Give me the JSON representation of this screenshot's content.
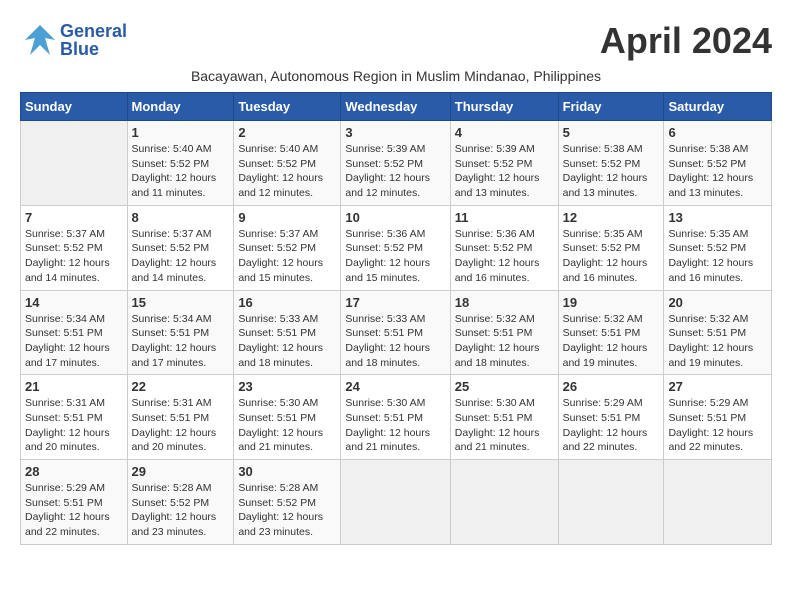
{
  "header": {
    "logo_general": "General",
    "logo_blue": "Blue",
    "month_title": "April 2024",
    "subtitle": "Bacayawan, Autonomous Region in Muslim Mindanao, Philippines"
  },
  "calendar": {
    "days_of_week": [
      "Sunday",
      "Monday",
      "Tuesday",
      "Wednesday",
      "Thursday",
      "Friday",
      "Saturday"
    ],
    "weeks": [
      [
        {
          "day": "",
          "sunrise": "",
          "sunset": "",
          "daylight": ""
        },
        {
          "day": "1",
          "sunrise": "Sunrise: 5:40 AM",
          "sunset": "Sunset: 5:52 PM",
          "daylight": "Daylight: 12 hours and 11 minutes."
        },
        {
          "day": "2",
          "sunrise": "Sunrise: 5:40 AM",
          "sunset": "Sunset: 5:52 PM",
          "daylight": "Daylight: 12 hours and 12 minutes."
        },
        {
          "day": "3",
          "sunrise": "Sunrise: 5:39 AM",
          "sunset": "Sunset: 5:52 PM",
          "daylight": "Daylight: 12 hours and 12 minutes."
        },
        {
          "day": "4",
          "sunrise": "Sunrise: 5:39 AM",
          "sunset": "Sunset: 5:52 PM",
          "daylight": "Daylight: 12 hours and 13 minutes."
        },
        {
          "day": "5",
          "sunrise": "Sunrise: 5:38 AM",
          "sunset": "Sunset: 5:52 PM",
          "daylight": "Daylight: 12 hours and 13 minutes."
        },
        {
          "day": "6",
          "sunrise": "Sunrise: 5:38 AM",
          "sunset": "Sunset: 5:52 PM",
          "daylight": "Daylight: 12 hours and 13 minutes."
        }
      ],
      [
        {
          "day": "7",
          "sunrise": "Sunrise: 5:37 AM",
          "sunset": "Sunset: 5:52 PM",
          "daylight": "Daylight: 12 hours and 14 minutes."
        },
        {
          "day": "8",
          "sunrise": "Sunrise: 5:37 AM",
          "sunset": "Sunset: 5:52 PM",
          "daylight": "Daylight: 12 hours and 14 minutes."
        },
        {
          "day": "9",
          "sunrise": "Sunrise: 5:37 AM",
          "sunset": "Sunset: 5:52 PM",
          "daylight": "Daylight: 12 hours and 15 minutes."
        },
        {
          "day": "10",
          "sunrise": "Sunrise: 5:36 AM",
          "sunset": "Sunset: 5:52 PM",
          "daylight": "Daylight: 12 hours and 15 minutes."
        },
        {
          "day": "11",
          "sunrise": "Sunrise: 5:36 AM",
          "sunset": "Sunset: 5:52 PM",
          "daylight": "Daylight: 12 hours and 16 minutes."
        },
        {
          "day": "12",
          "sunrise": "Sunrise: 5:35 AM",
          "sunset": "Sunset: 5:52 PM",
          "daylight": "Daylight: 12 hours and 16 minutes."
        },
        {
          "day": "13",
          "sunrise": "Sunrise: 5:35 AM",
          "sunset": "Sunset: 5:52 PM",
          "daylight": "Daylight: 12 hours and 16 minutes."
        }
      ],
      [
        {
          "day": "14",
          "sunrise": "Sunrise: 5:34 AM",
          "sunset": "Sunset: 5:51 PM",
          "daylight": "Daylight: 12 hours and 17 minutes."
        },
        {
          "day": "15",
          "sunrise": "Sunrise: 5:34 AM",
          "sunset": "Sunset: 5:51 PM",
          "daylight": "Daylight: 12 hours and 17 minutes."
        },
        {
          "day": "16",
          "sunrise": "Sunrise: 5:33 AM",
          "sunset": "Sunset: 5:51 PM",
          "daylight": "Daylight: 12 hours and 18 minutes."
        },
        {
          "day": "17",
          "sunrise": "Sunrise: 5:33 AM",
          "sunset": "Sunset: 5:51 PM",
          "daylight": "Daylight: 12 hours and 18 minutes."
        },
        {
          "day": "18",
          "sunrise": "Sunrise: 5:32 AM",
          "sunset": "Sunset: 5:51 PM",
          "daylight": "Daylight: 12 hours and 18 minutes."
        },
        {
          "day": "19",
          "sunrise": "Sunrise: 5:32 AM",
          "sunset": "Sunset: 5:51 PM",
          "daylight": "Daylight: 12 hours and 19 minutes."
        },
        {
          "day": "20",
          "sunrise": "Sunrise: 5:32 AM",
          "sunset": "Sunset: 5:51 PM",
          "daylight": "Daylight: 12 hours and 19 minutes."
        }
      ],
      [
        {
          "day": "21",
          "sunrise": "Sunrise: 5:31 AM",
          "sunset": "Sunset: 5:51 PM",
          "daylight": "Daylight: 12 hours and 20 minutes."
        },
        {
          "day": "22",
          "sunrise": "Sunrise: 5:31 AM",
          "sunset": "Sunset: 5:51 PM",
          "daylight": "Daylight: 12 hours and 20 minutes."
        },
        {
          "day": "23",
          "sunrise": "Sunrise: 5:30 AM",
          "sunset": "Sunset: 5:51 PM",
          "daylight": "Daylight: 12 hours and 21 minutes."
        },
        {
          "day": "24",
          "sunrise": "Sunrise: 5:30 AM",
          "sunset": "Sunset: 5:51 PM",
          "daylight": "Daylight: 12 hours and 21 minutes."
        },
        {
          "day": "25",
          "sunrise": "Sunrise: 5:30 AM",
          "sunset": "Sunset: 5:51 PM",
          "daylight": "Daylight: 12 hours and 21 minutes."
        },
        {
          "day": "26",
          "sunrise": "Sunrise: 5:29 AM",
          "sunset": "Sunset: 5:51 PM",
          "daylight": "Daylight: 12 hours and 22 minutes."
        },
        {
          "day": "27",
          "sunrise": "Sunrise: 5:29 AM",
          "sunset": "Sunset: 5:51 PM",
          "daylight": "Daylight: 12 hours and 22 minutes."
        }
      ],
      [
        {
          "day": "28",
          "sunrise": "Sunrise: 5:29 AM",
          "sunset": "Sunset: 5:51 PM",
          "daylight": "Daylight: 12 hours and 22 minutes."
        },
        {
          "day": "29",
          "sunrise": "Sunrise: 5:28 AM",
          "sunset": "Sunset: 5:52 PM",
          "daylight": "Daylight: 12 hours and 23 minutes."
        },
        {
          "day": "30",
          "sunrise": "Sunrise: 5:28 AM",
          "sunset": "Sunset: 5:52 PM",
          "daylight": "Daylight: 12 hours and 23 minutes."
        },
        {
          "day": "",
          "sunrise": "",
          "sunset": "",
          "daylight": ""
        },
        {
          "day": "",
          "sunrise": "",
          "sunset": "",
          "daylight": ""
        },
        {
          "day": "",
          "sunrise": "",
          "sunset": "",
          "daylight": ""
        },
        {
          "day": "",
          "sunrise": "",
          "sunset": "",
          "daylight": ""
        }
      ]
    ]
  }
}
